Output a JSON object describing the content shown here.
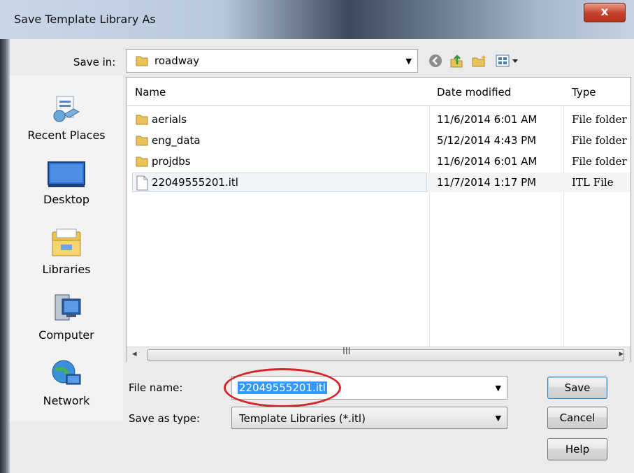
{
  "window": {
    "title": "Save Template Library As",
    "close_label": "x"
  },
  "save_in": {
    "label": "Save in:",
    "value": "roadway"
  },
  "toolbar": {
    "icons": [
      "back-icon",
      "up-folder-icon",
      "new-folder-icon",
      "view-menu-icon"
    ]
  },
  "places": [
    {
      "label": "Recent Places",
      "icon": "recent-places-icon"
    },
    {
      "label": "Desktop",
      "icon": "desktop-icon"
    },
    {
      "label": "Libraries",
      "icon": "libraries-icon"
    },
    {
      "label": "Computer",
      "icon": "computer-icon"
    },
    {
      "label": "Network",
      "icon": "network-icon"
    }
  ],
  "columns": {
    "name": "Name",
    "date": "Date modified",
    "type": "Type"
  },
  "files": [
    {
      "name": "aerials",
      "date": "11/6/2014 6:01 AM",
      "type": "File folder",
      "icon": "folder-icon"
    },
    {
      "name": "eng_data",
      "date": "5/12/2014 4:43 PM",
      "type": "File folder",
      "icon": "folder-icon"
    },
    {
      "name": "projdbs",
      "date": "11/6/2014 6:01 AM",
      "type": "File folder",
      "icon": "folder-icon"
    },
    {
      "name": "22049555201.itl",
      "date": "11/7/2014 1:17 PM",
      "type": "ITL File",
      "icon": "file-icon"
    }
  ],
  "scrollbar": {
    "left_arrow": "◂",
    "right_arrow": "▸",
    "grip": "III"
  },
  "file_name": {
    "label": "File name:",
    "value": "22049555201.itl"
  },
  "save_as_type": {
    "label": "Save as type:",
    "value": "Template Libraries (*.itl)"
  },
  "buttons": {
    "save": "Save",
    "cancel": "Cancel",
    "help": "Help"
  }
}
